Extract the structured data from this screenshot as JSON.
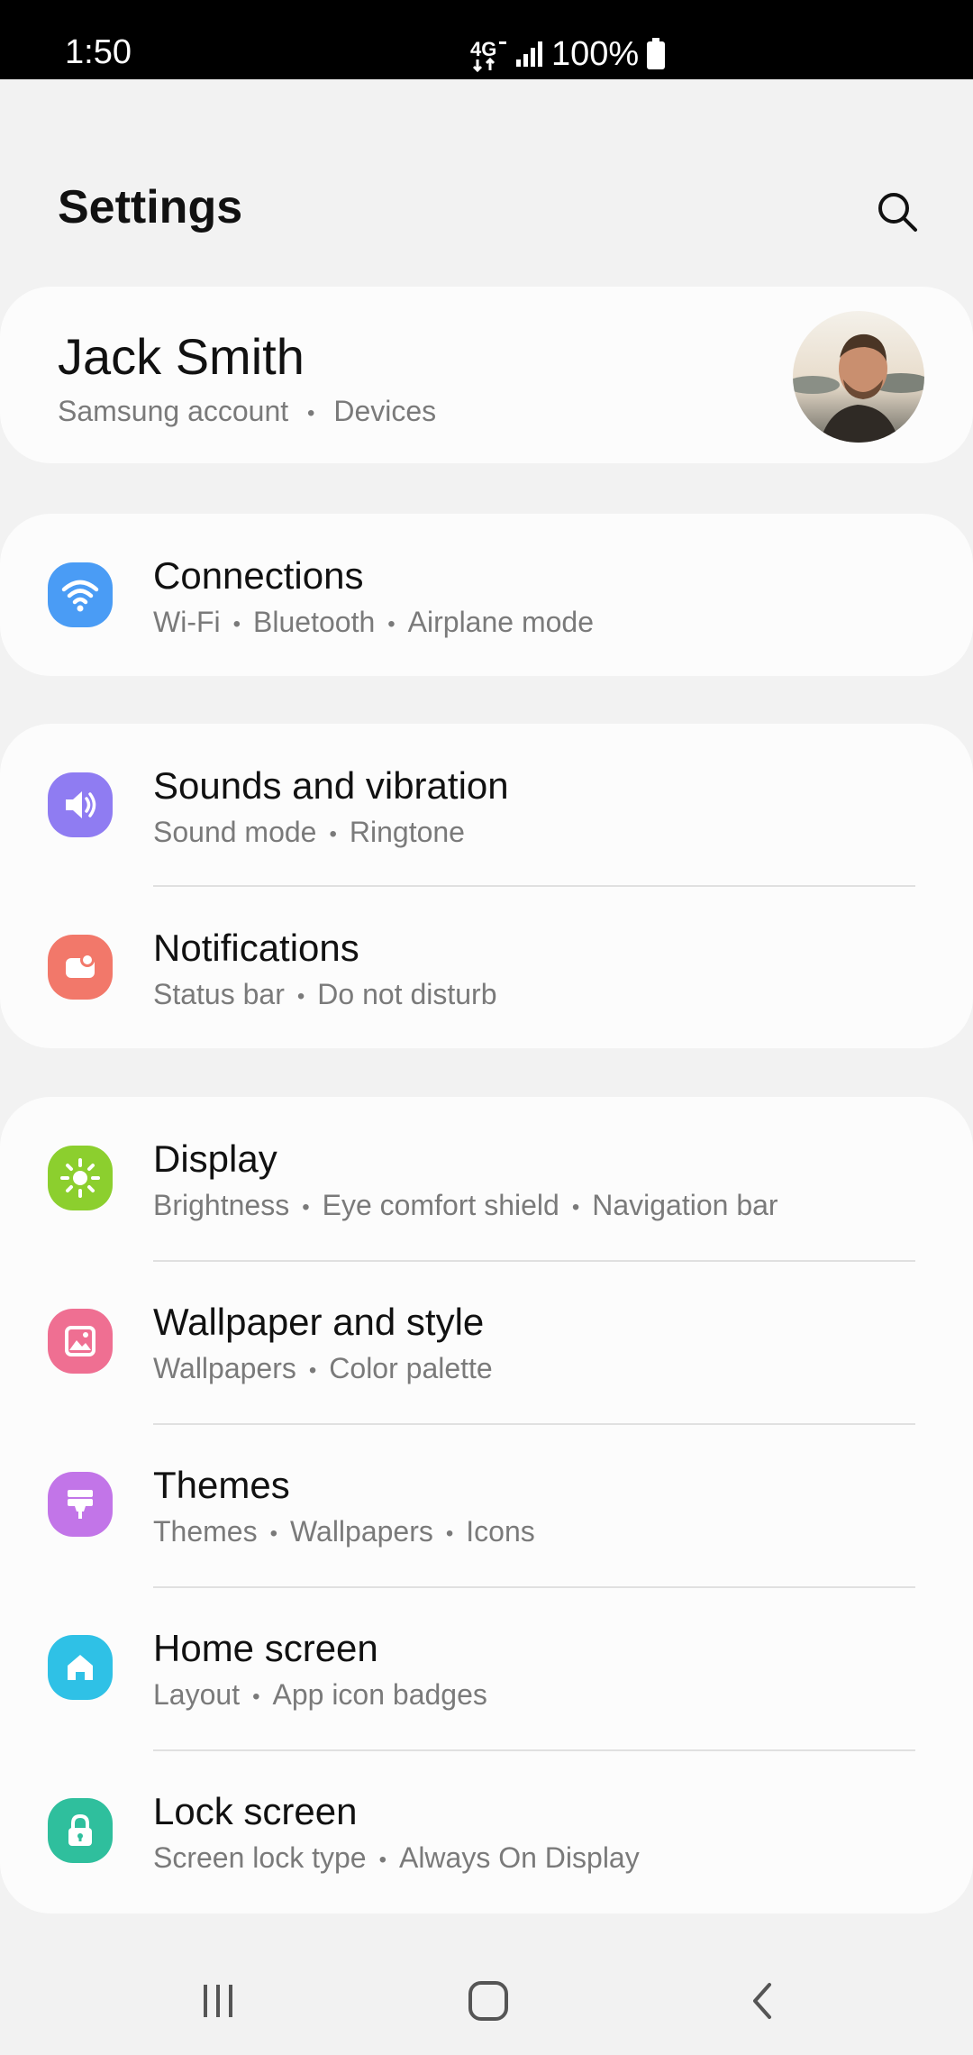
{
  "status_bar": {
    "time": "1:50",
    "network": "4G",
    "battery": "100%"
  },
  "header": {
    "title": "Settings",
    "search_icon": "search-icon"
  },
  "account": {
    "name": "Jack Smith",
    "sub_1": "Samsung account",
    "sub_2": "Devices",
    "separator": "•"
  },
  "groups": [
    {
      "items": [
        {
          "label": "Connections",
          "subs": [
            "Wi-Fi",
            "Bluetooth",
            "Airplane mode"
          ],
          "icon": "wifi-icon",
          "color": "#4a9cf5"
        }
      ]
    },
    {
      "items": [
        {
          "label": "Sounds and vibration",
          "subs": [
            "Sound mode",
            "Ringtone"
          ],
          "icon": "speaker-icon",
          "color": "#8f7cf2"
        },
        {
          "label": "Notifications",
          "subs": [
            "Status bar",
            "Do not disturb"
          ],
          "icon": "notification-icon",
          "color": "#f2786a"
        }
      ]
    },
    {
      "items": [
        {
          "label": "Display",
          "subs": [
            "Brightness",
            "Eye comfort shield",
            "Navigation bar"
          ],
          "icon": "sun-icon",
          "color": "#8ccf2e"
        },
        {
          "label": "Wallpaper and style",
          "subs": [
            "Wallpapers",
            "Color palette"
          ],
          "icon": "image-icon",
          "color": "#ef6f92"
        },
        {
          "label": "Themes",
          "subs": [
            "Themes",
            "Wallpapers",
            "Icons"
          ],
          "icon": "brush-icon",
          "color": "#c275e8"
        },
        {
          "label": "Home screen",
          "subs": [
            "Layout",
            "App icon badges"
          ],
          "icon": "home-icon",
          "color": "#2fc1e6"
        },
        {
          "label": "Lock screen",
          "subs": [
            "Screen lock type",
            "Always On Display"
          ],
          "icon": "lock-icon",
          "color": "#2fbf9d"
        }
      ]
    }
  ],
  "nav_bar": {
    "recents_icon": "recents-icon",
    "home_icon": "home-button-icon",
    "back_icon": "back-icon"
  }
}
